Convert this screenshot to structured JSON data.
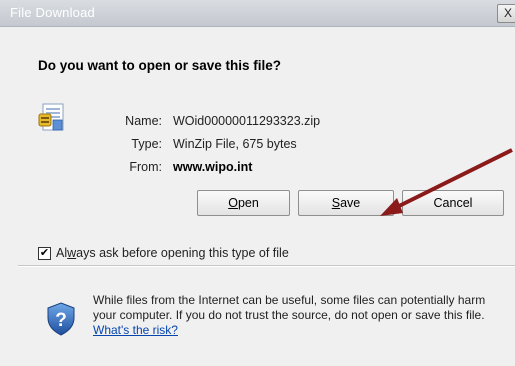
{
  "window": {
    "title": "File Download",
    "close_glyph": "X"
  },
  "dialog": {
    "question": "Do you want to open or save this file?",
    "file_icon": "zip-file-icon",
    "info": {
      "name_label": "Name:",
      "name_value": "WOid00000011293323.zip",
      "type_label": "Type:",
      "type_value": "WinZip File, 675 bytes",
      "from_label": "From:",
      "from_value": "www.wipo.int"
    },
    "buttons": {
      "open_accel": "O",
      "open_rest": "pen",
      "save_accel": "S",
      "save_rest": "ave",
      "cancel": "Cancel"
    },
    "checkbox": {
      "checked": true,
      "mark": "✔",
      "label_prefix": "Al",
      "label_accel": "w",
      "label_rest": "ays ask before opening this type of file"
    }
  },
  "warning": {
    "icon": "shield-question-icon",
    "text": "While files from the Internet can be useful, some files can potentially harm your computer. If you do not trust the source, do not open or save this file. ",
    "link": "What's the risk?"
  },
  "annotation": {
    "arrow_color": "#8b1a1a"
  }
}
